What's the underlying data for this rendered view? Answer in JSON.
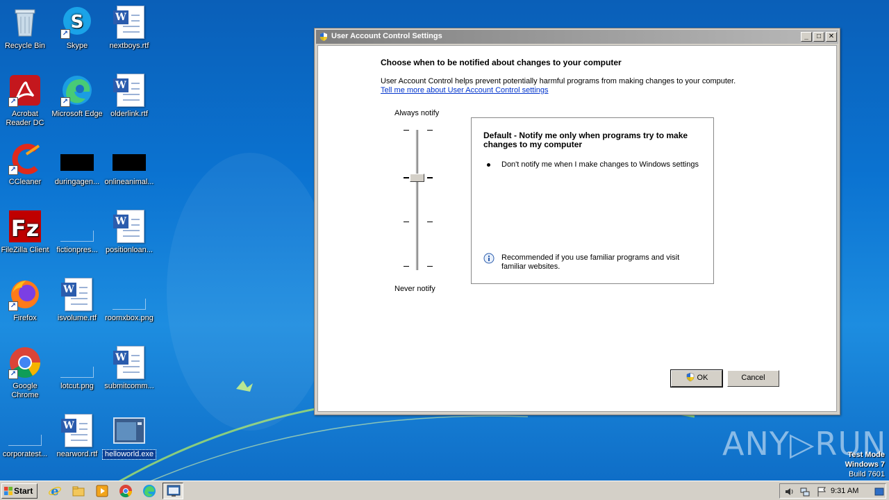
{
  "desktop": {
    "icons": [
      {
        "label": "Recycle Bin"
      },
      {
        "label": "Skype"
      },
      {
        "label": "nextboys.rtf"
      },
      {
        "label": "Acrobat Reader DC"
      },
      {
        "label": "Microsoft Edge"
      },
      {
        "label": "olderlink.rtf"
      },
      {
        "label": "CCleaner"
      },
      {
        "label": "duringagen..."
      },
      {
        "label": "onlineanimal..."
      },
      {
        "label": "FileZilla Client"
      },
      {
        "label": "fictionpres..."
      },
      {
        "label": "positionloan..."
      },
      {
        "label": "Firefox"
      },
      {
        "label": "isvolume.rtf"
      },
      {
        "label": "roomxbox.png"
      },
      {
        "label": "Google Chrome"
      },
      {
        "label": "lotcut.png"
      },
      {
        "label": "submitcomm..."
      },
      {
        "label": "corporatest..."
      },
      {
        "label": "nearword.rtf"
      },
      {
        "label": "helloworld.exe"
      }
    ]
  },
  "dialog": {
    "title": "User Account Control Settings",
    "heading": "Choose when to be notified about changes to your computer",
    "description": "User Account Control helps prevent potentially harmful programs from making changes to your computer.",
    "link": "Tell me more about User Account Control settings",
    "slider_top_label": "Always notify",
    "slider_bottom_label": "Never notify",
    "slider_level": 3,
    "slider_levels": 4,
    "info_title": "Default - Notify me only when programs try to make changes to my computer",
    "info_bullet": "Don't notify me when I make changes to Windows settings",
    "info_recommendation": "Recommended if you use familiar programs and visit familiar websites.",
    "ok_label": "OK",
    "cancel_label": "Cancel",
    "minimize_glyph": "_",
    "maximize_glyph": "□",
    "close_glyph": "✕"
  },
  "watermark": "ANY▷RUN",
  "os_info": {
    "line1": "Test Mode",
    "line2": "Windows 7",
    "line3": "Build 7601"
  },
  "taskbar": {
    "start_label": "Start",
    "clock": "9:31 AM",
    "pinned": [
      "ie-icon",
      "explorer-icon",
      "media-player-icon",
      "chrome-icon",
      "edge-icon",
      "uac-window-icon"
    ]
  }
}
